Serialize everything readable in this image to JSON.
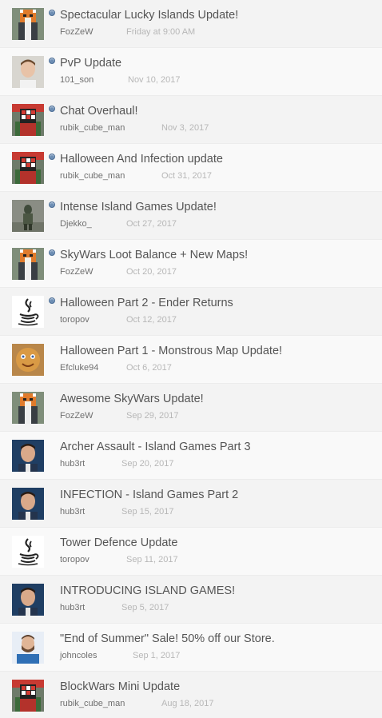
{
  "threads": [
    {
      "title": "Spectacular Lucky Islands Update!",
      "author": "FozZeW",
      "date": "Friday at 9:00 AM",
      "unread": true,
      "avatar": "fox-minecraft-avatar"
    },
    {
      "title": "PvP Update",
      "author": "101_son",
      "date": "Nov 10, 2017",
      "unread": true,
      "avatar": "portrait-photo-avatar"
    },
    {
      "title": "Chat Overhaul!",
      "author": "rubik_cube_man",
      "date": "Nov 3, 2017",
      "unread": true,
      "avatar": "rubik-cube-avatar"
    },
    {
      "title": "Halloween And Infection update",
      "author": "rubik_cube_man",
      "date": "Oct 31, 2017",
      "unread": true,
      "avatar": "rubik-cube-avatar"
    },
    {
      "title": "Intense Island Games Update!",
      "author": "Djekko_",
      "date": "Oct 27, 2017",
      "unread": true,
      "avatar": "soldier-avatar"
    },
    {
      "title": "SkyWars Loot Balance + New Maps!",
      "author": "FozZeW",
      "date": "Oct 20, 2017",
      "unread": true,
      "avatar": "fox-minecraft-avatar"
    },
    {
      "title": "Halloween Part 2 - Ender Returns",
      "author": "toropov",
      "date": "Oct 12, 2017",
      "unread": true,
      "avatar": "java-logo-avatar"
    },
    {
      "title": "Halloween Part 1 - Monstrous Map Update!",
      "author": "Efcluke94",
      "date": "Oct 6, 2017",
      "unread": false,
      "avatar": "gingerbread-avatar"
    },
    {
      "title": "Awesome SkyWars Update!",
      "author": "FozZeW",
      "date": "Sep 29, 2017",
      "unread": false,
      "avatar": "fox-minecraft-avatar"
    },
    {
      "title": "Archer Assault - Island Games Part 3",
      "author": "hub3rt",
      "date": "Sep 20, 2017",
      "unread": false,
      "avatar": "man-portrait-avatar"
    },
    {
      "title": "INFECTION - Island Games Part 2",
      "author": "hub3rt",
      "date": "Sep 15, 2017",
      "unread": false,
      "avatar": "man-portrait-avatar"
    },
    {
      "title": "Tower Defence Update",
      "author": "toropov",
      "date": "Sep 11, 2017",
      "unread": false,
      "avatar": "java-logo-avatar"
    },
    {
      "title": "INTRODUCING ISLAND GAMES!",
      "author": "hub3rt",
      "date": "Sep 5, 2017",
      "unread": false,
      "avatar": "man-portrait-avatar"
    },
    {
      "title": "\"End of Summer\" Sale! 50% off our Store.",
      "author": "johncoles",
      "date": "Sep 1, 2017",
      "unread": false,
      "avatar": "bearded-man-avatar"
    },
    {
      "title": "BlockWars Mini Update",
      "author": "rubik_cube_man",
      "date": "Aug 18, 2017",
      "unread": false,
      "avatar": "rubik-cube-avatar"
    }
  ],
  "colors": {
    "title": "#555555",
    "author": "#6f6f6f",
    "date": "#b7b7b7",
    "unread_dot": "#6d8eb4",
    "accent_bar": [
      "#1e3a5c",
      "#2d6aa1",
      "#244e77",
      "#f2c43c"
    ]
  }
}
